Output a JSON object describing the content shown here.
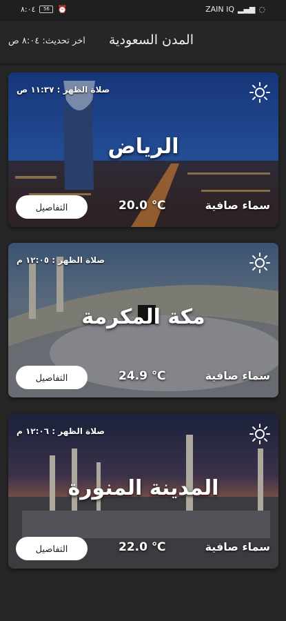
{
  "status_bar": {
    "time": "٨:٠٤",
    "battery": "56",
    "carrier": "ZAIN IQ"
  },
  "header": {
    "title": "المدن السعودية",
    "last_update": "اخر تحديث: ٨:٠٤ ص"
  },
  "cities": [
    {
      "name": "الرياض",
      "prayer": "صلاة الظهر : ١١:٣٧ ص",
      "temperature": "20.0 ℃",
      "condition": "سماء صافية",
      "details_label": "التفاصيل",
      "icon": "sun-icon"
    },
    {
      "name": "مكة المكرمة",
      "prayer": "صلاة الظهر : ١٢:٠٥ م",
      "temperature": "24.9 ℃",
      "condition": "سماء صافية",
      "details_label": "التفاصيل",
      "icon": "sun-icon"
    },
    {
      "name": "المدينة المنورة",
      "prayer": "صلاة الظهر : ١٢:٠٦ م",
      "temperature": "22.0 ℃",
      "condition": "سماء صافية",
      "details_label": "التفاصيل",
      "icon": "sun-icon"
    }
  ]
}
